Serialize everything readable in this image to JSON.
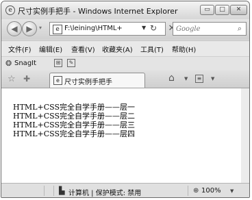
{
  "window": {
    "title": "尺寸实例手把手 - Windows Internet Explorer",
    "controls": {
      "minimize": "▭",
      "maximize": "□",
      "close": "✕"
    }
  },
  "address_bar": {
    "url": "F:\\leining\\HTML+",
    "search_placeholder": "Google"
  },
  "menu": {
    "items": [
      "文件(F)",
      "编辑(E)",
      "查看(V)",
      "收藏夹(A)",
      "工具(T)",
      "帮助(H)"
    ]
  },
  "links_bar": {
    "snagit_label": "SnagIt"
  },
  "tab": {
    "label": "尺寸实例手把手"
  },
  "content": {
    "lines": [
      "HTML+CSS完全自学手册——层一",
      "HTML+CSS完全自学手册——层二",
      "HTML+CSS完全自学手册——层三",
      "HTML+CSS完全自学手册——层四"
    ]
  },
  "status_bar": {
    "zone": "计算机 | 保护模式: 禁用",
    "zoom": "100%"
  },
  "icons": {
    "app": "ie-icon",
    "page": "page-icon",
    "search": "search-icon",
    "home": "home-icon",
    "feed": "feed-icon"
  }
}
